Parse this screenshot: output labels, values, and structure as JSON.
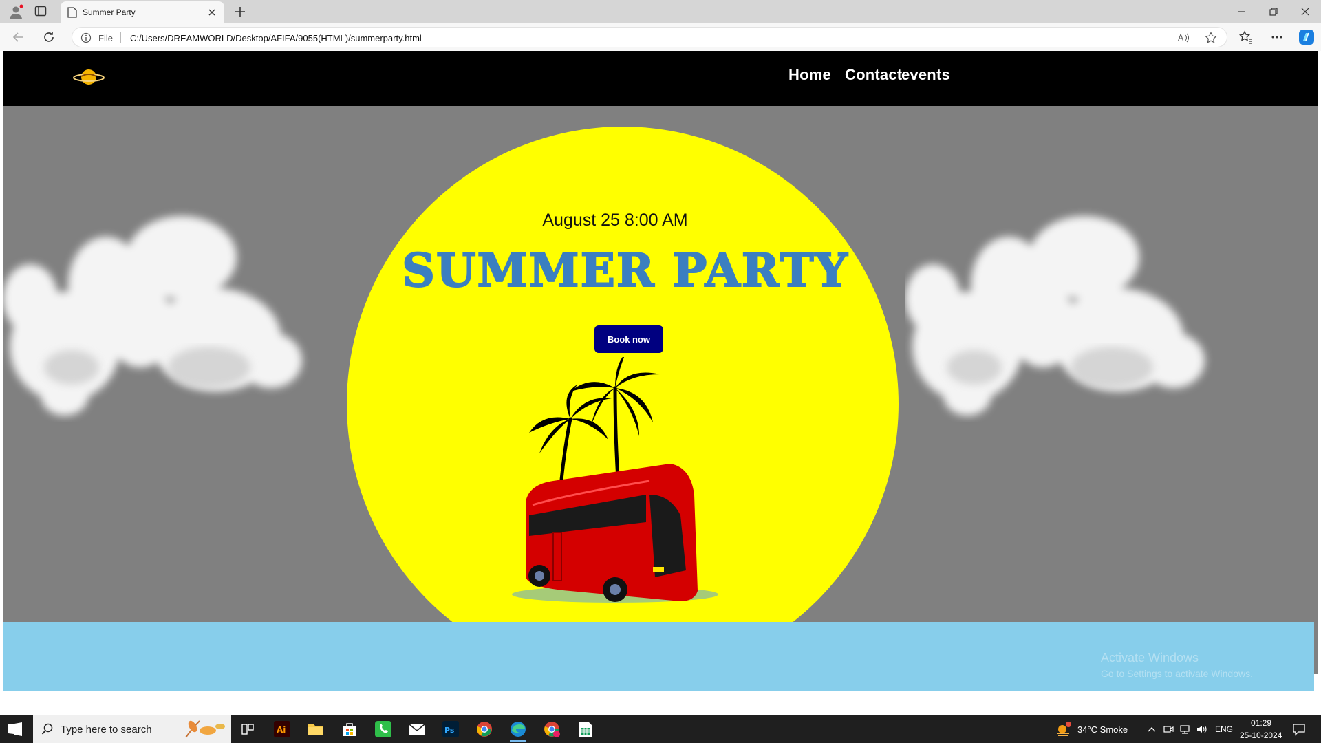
{
  "browser": {
    "tab_title": "Summer Party",
    "omnibox_scheme": "File",
    "url": "C:/Users/DREAMWORLD/Desktop/AFIFA/9055(HTML)/summerparty.html"
  },
  "site": {
    "nav": [
      "Home",
      "Contact",
      "events"
    ],
    "date": "August 25 8:00 AM",
    "headline": "SUMMER PARTY",
    "cta": "Book now"
  },
  "watermark": {
    "title": "Activate Windows",
    "subtitle": "Go to Settings to activate Windows."
  },
  "taskbar": {
    "search_placeholder": "Type here to search",
    "weather": "34°C  Smoke",
    "lang": "ENG",
    "time": "01:29",
    "date": "25-10-2024"
  },
  "colors": {
    "nav_bg": "#000000",
    "sky": "#808080",
    "sun": "#ffff00",
    "headline": "#3b7fc0",
    "button": "#000080",
    "ground": "#87ceeb",
    "bus": "#d40000"
  }
}
